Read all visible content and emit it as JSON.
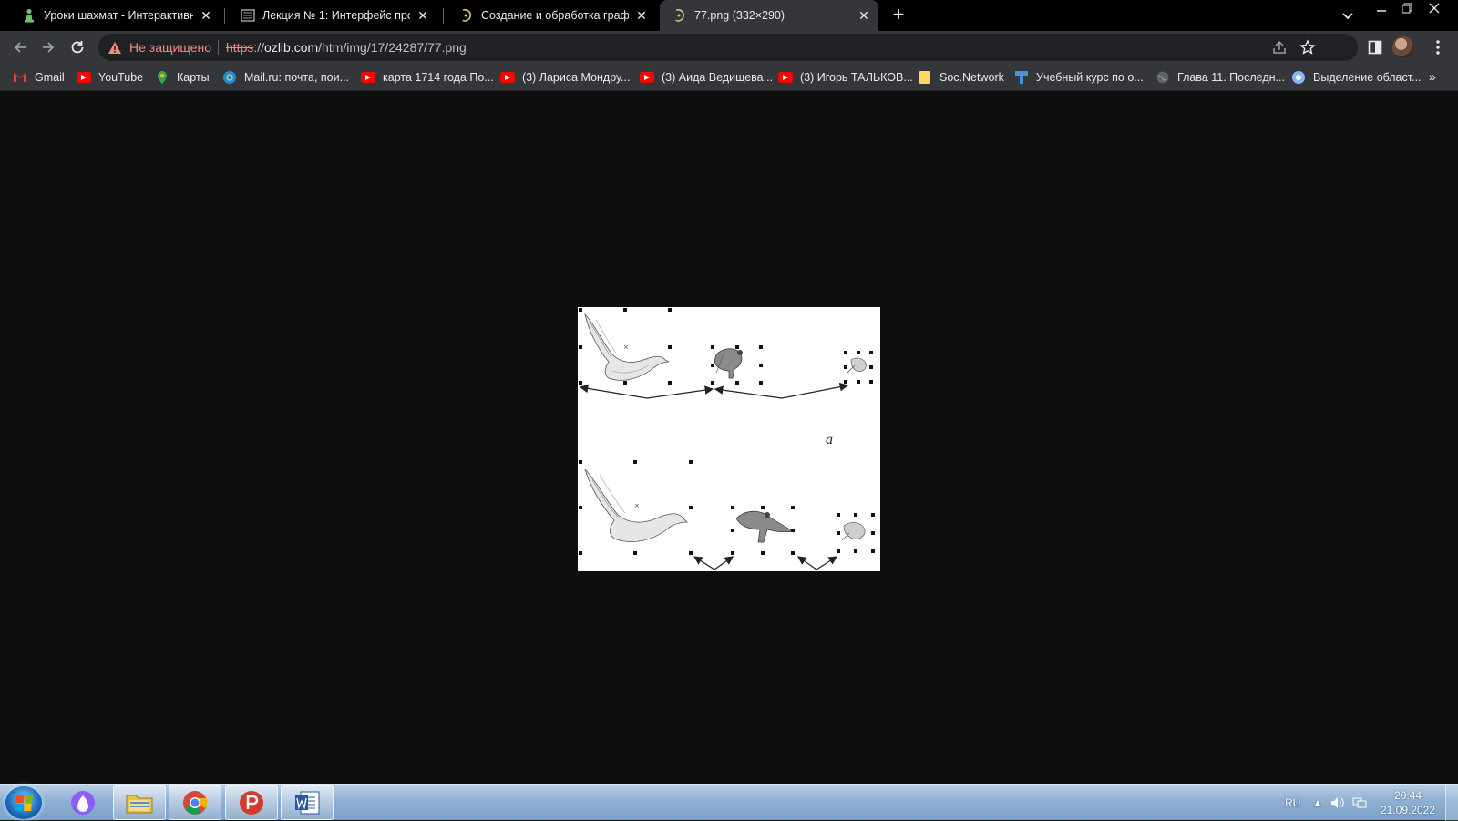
{
  "browser": {
    "tabs": [
      {
        "title": "Уроки шахмат - Интерактивные",
        "favicon": "chess-pawn-icon",
        "active": false
      },
      {
        "title": "Лекция № 1: Интерфейс програ",
        "favicon": "lecture-icon",
        "active": false
      },
      {
        "title": "Создание и обработка графиче",
        "favicon": "ozlib-icon",
        "active": false
      },
      {
        "title": "77.png (332×290)",
        "favicon": "ozlib-icon",
        "active": true
      }
    ],
    "security_label": "Не защищено",
    "url": {
      "scheme": "https",
      "sep": "://",
      "host": "ozlib.com",
      "path": "/htm/img/17/24287/77.png"
    },
    "bookmarks": [
      {
        "label": "Gmail",
        "icon": "gmail-icon"
      },
      {
        "label": "YouTube",
        "icon": "youtube-icon"
      },
      {
        "label": "Карты",
        "icon": "maps-icon"
      },
      {
        "label": "Mail.ru: почта, пои...",
        "icon": "mailru-icon"
      },
      {
        "label": "карта 1714 года По...",
        "icon": "youtube-icon"
      },
      {
        "label": "(3) Лариса Мондру...",
        "icon": "youtube-icon"
      },
      {
        "label": "(3) Аида Ведищева...",
        "icon": "youtube-icon"
      },
      {
        "label": "(3) Игорь ТАЛЬКОВ...",
        "icon": "youtube-icon"
      },
      {
        "label": "Soc.Network",
        "icon": "folder-icon"
      },
      {
        "label": "Учебный курс по о...",
        "icon": "course-icon"
      },
      {
        "label": "Глава 11. Последн...",
        "icon": "globe-icon"
      },
      {
        "label": "Выделение област...",
        "icon": "chrome-ext-icon"
      }
    ],
    "bookmarks_more": "»"
  },
  "content": {
    "image_label": "а"
  },
  "taskbar": {
    "apps": [
      "start-button",
      "alice-icon",
      "explorer-icon",
      "chrome-icon",
      "presenter-icon",
      "word-icon"
    ],
    "language": "RU",
    "time": "20:44",
    "date": "21.09.2022"
  },
  "colors": {
    "tab_strip": "#000000",
    "toolbar": "#35363a",
    "omnibox": "#202124",
    "warning": "#f28b82",
    "page_bg": "#0e0e0e"
  }
}
